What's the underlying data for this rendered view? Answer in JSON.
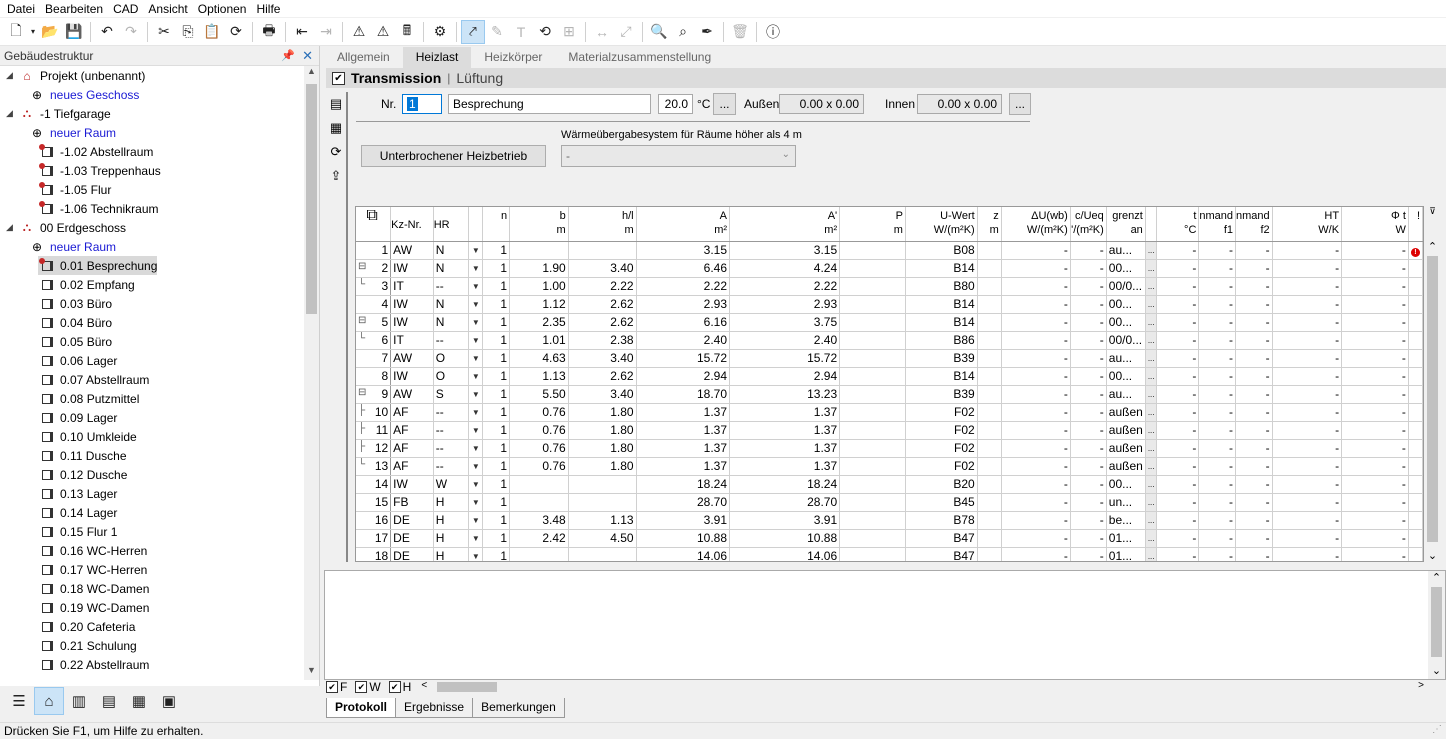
{
  "menu": [
    "Datei",
    "Bearbeiten",
    "CAD",
    "Ansicht",
    "Optionen",
    "Hilfe"
  ],
  "left_panel": {
    "title": "Gebäudestruktur",
    "tree": [
      {
        "label": "Projekt (unbenannt)",
        "level": 0,
        "icon": "project-icon",
        "exp": "◢"
      },
      {
        "label": "neues Geschoss",
        "level": 1,
        "icon": "add-icon",
        "blue": true
      },
      {
        "label": "-1 Tiefgarage",
        "level": 0,
        "icon": "floor-icon",
        "exp": "◢"
      },
      {
        "label": "neuer Raum",
        "level": 1,
        "icon": "add-icon",
        "blue": true
      },
      {
        "label": "-1.02 Abstellraum",
        "level": 1,
        "icon": "room-warn-icon"
      },
      {
        "label": "-1.03 Treppenhaus",
        "level": 1,
        "icon": "room-warn-icon"
      },
      {
        "label": "-1.05 Flur",
        "level": 1,
        "icon": "room-warn-icon"
      },
      {
        "label": "-1.06 Technikraum",
        "level": 1,
        "icon": "room-warn-icon"
      },
      {
        "label": "00 Erdgeschoss",
        "level": 0,
        "icon": "floor-icon",
        "exp": "◢"
      },
      {
        "label": "neuer Raum",
        "level": 1,
        "icon": "add-icon",
        "blue": true
      },
      {
        "label": "0.01 Besprechung",
        "level": 1,
        "icon": "room-warn-icon",
        "selected": true
      },
      {
        "label": "0.02 Empfang",
        "level": 1,
        "icon": "room-icon"
      },
      {
        "label": "0.03 Büro",
        "level": 1,
        "icon": "room-icon"
      },
      {
        "label": "0.04 Büro",
        "level": 1,
        "icon": "room-icon"
      },
      {
        "label": "0.05 Büro",
        "level": 1,
        "icon": "room-icon"
      },
      {
        "label": "0.06 Lager",
        "level": 1,
        "icon": "room-icon"
      },
      {
        "label": "0.07 Abstellraum",
        "level": 1,
        "icon": "room-icon"
      },
      {
        "label": "0.08 Putzmittel",
        "level": 1,
        "icon": "room-icon"
      },
      {
        "label": "0.09 Lager",
        "level": 1,
        "icon": "room-icon"
      },
      {
        "label": "0.10 Umkleide",
        "level": 1,
        "icon": "room-icon"
      },
      {
        "label": "0.11 Dusche",
        "level": 1,
        "icon": "room-icon"
      },
      {
        "label": "0.12 Dusche",
        "level": 1,
        "icon": "room-icon"
      },
      {
        "label": "0.13 Lager",
        "level": 1,
        "icon": "room-icon"
      },
      {
        "label": "0.14 Lager",
        "level": 1,
        "icon": "room-icon"
      },
      {
        "label": "0.15 Flur 1",
        "level": 1,
        "icon": "room-icon"
      },
      {
        "label": "0.16 WC-Herren",
        "level": 1,
        "icon": "room-icon"
      },
      {
        "label": "0.17 WC-Herren",
        "level": 1,
        "icon": "room-icon"
      },
      {
        "label": "0.18 WC-Damen",
        "level": 1,
        "icon": "room-icon"
      },
      {
        "label": "0.19 WC-Damen",
        "level": 1,
        "icon": "room-icon"
      },
      {
        "label": "0.20 Cafeteria",
        "level": 1,
        "icon": "room-icon"
      },
      {
        "label": "0.21 Schulung",
        "level": 1,
        "icon": "room-icon"
      },
      {
        "label": "0.22 Abstellraum",
        "level": 1,
        "icon": "room-icon"
      }
    ]
  },
  "tabs": [
    "Allgemein",
    "Heizlast",
    "Heizkörper",
    "Materialzusammenstellung"
  ],
  "active_tab": "Heizlast",
  "section": {
    "title": "Transmission",
    "sub": "Lüftung"
  },
  "form": {
    "nr_label": "Nr.",
    "nr_value": "1",
    "name": "Besprechung",
    "temp": "20.0",
    "unit": "°C",
    "dots": "...",
    "aussen_label": "Außen",
    "aussen_value": "0.00 x 0.00",
    "innen_label": "Innen",
    "innen_value": "0.00 x 0.00",
    "interrupt_button": "Unterbrochener Heizbetrieb",
    "system_label": "Wärmeübergabesystem für Räume höher als 4 m",
    "system_value": "-"
  },
  "columns": [
    {
      "h1": "",
      "h2": ""
    },
    {
      "h1": "Kz-Nr.",
      "h2": ""
    },
    {
      "h1": "HR",
      "h2": ""
    },
    {
      "h1": "",
      "h2": ""
    },
    {
      "h1": "n",
      "h2": ""
    },
    {
      "h1": "b",
      "h2": "m"
    },
    {
      "h1": "h/l",
      "h2": "m"
    },
    {
      "h1": "A",
      "h2": "m²"
    },
    {
      "h1": "A'",
      "h2": "m²"
    },
    {
      "h1": "P",
      "h2": "m"
    },
    {
      "h1": "U-Wert",
      "h2": "W/(m²K)"
    },
    {
      "h1": "z",
      "h2": "m"
    },
    {
      "h1": "ΔU(wb)",
      "h2": "W/(m²K)"
    },
    {
      "h1": "c/Ueq",
      "h2": "'/(m²K)"
    },
    {
      "h1": "grenzt",
      "h2": "an"
    },
    {
      "h1": "",
      "h2": ""
    },
    {
      "h1": "t",
      "h2": "°C"
    },
    {
      "h1": "nmand",
      "h2": "f1"
    },
    {
      "h1": "nmand",
      "h2": "f2"
    },
    {
      "h1": "HT",
      "h2": "W/K"
    },
    {
      "h1": "Φ t",
      "h2": "W"
    },
    {
      "h1": "!",
      "h2": ""
    }
  ],
  "rows": [
    {
      "n": "1",
      "kz": "AW",
      "hr": "N",
      "cnt": "1",
      "b": "",
      "h": "",
      "a": "3.15",
      "a2": "3.15",
      "u": "B08",
      "g": "au...",
      "warn": true,
      "tree": ""
    },
    {
      "n": "2",
      "kz": "IW",
      "hr": "N",
      "cnt": "1",
      "b": "1.90",
      "h": "3.40",
      "a": "6.46",
      "a2": "4.24",
      "u": "B14",
      "g": "00...",
      "tree": "⊟"
    },
    {
      "n": "3",
      "kz": "IT",
      "hr": "--",
      "cnt": "1",
      "b": "1.00",
      "h": "2.22",
      "a": "2.22",
      "a2": "2.22",
      "u": "B80",
      "g": "00/0...",
      "tree": "└"
    },
    {
      "n": "4",
      "kz": "IW",
      "hr": "N",
      "cnt": "1",
      "b": "1.12",
      "h": "2.62",
      "a": "2.93",
      "a2": "2.93",
      "u": "B14",
      "g": "00...",
      "tree": ""
    },
    {
      "n": "5",
      "kz": "IW",
      "hr": "N",
      "cnt": "1",
      "b": "2.35",
      "h": "2.62",
      "a": "6.16",
      "a2": "3.75",
      "u": "B14",
      "g": "00...",
      "tree": "⊟"
    },
    {
      "n": "6",
      "kz": "IT",
      "hr": "--",
      "cnt": "1",
      "b": "1.01",
      "h": "2.38",
      "a": "2.40",
      "a2": "2.40",
      "u": "B86",
      "g": "00/0...",
      "tree": "└"
    },
    {
      "n": "7",
      "kz": "AW",
      "hr": "O",
      "cnt": "1",
      "b": "4.63",
      "h": "3.40",
      "a": "15.72",
      "a2": "15.72",
      "u": "B39",
      "g": "au...",
      "tree": ""
    },
    {
      "n": "8",
      "kz": "IW",
      "hr": "O",
      "cnt": "1",
      "b": "1.13",
      "h": "2.62",
      "a": "2.94",
      "a2": "2.94",
      "u": "B14",
      "g": "00...",
      "tree": ""
    },
    {
      "n": "9",
      "kz": "AW",
      "hr": "S",
      "cnt": "1",
      "b": "5.50",
      "h": "3.40",
      "a": "18.70",
      "a2": "13.23",
      "u": "B39",
      "g": "au...",
      "tree": "⊟"
    },
    {
      "n": "10",
      "kz": "AF",
      "hr": "--",
      "cnt": "1",
      "b": "0.76",
      "h": "1.80",
      "a": "1.37",
      "a2": "1.37",
      "u": "F02",
      "g": "außen",
      "tree": "├"
    },
    {
      "n": "11",
      "kz": "AF",
      "hr": "--",
      "cnt": "1",
      "b": "0.76",
      "h": "1.80",
      "a": "1.37",
      "a2": "1.37",
      "u": "F02",
      "g": "außen",
      "tree": "├"
    },
    {
      "n": "12",
      "kz": "AF",
      "hr": "--",
      "cnt": "1",
      "b": "0.76",
      "h": "1.80",
      "a": "1.37",
      "a2": "1.37",
      "u": "F02",
      "g": "außen",
      "tree": "├"
    },
    {
      "n": "13",
      "kz": "AF",
      "hr": "--",
      "cnt": "1",
      "b": "0.76",
      "h": "1.80",
      "a": "1.37",
      "a2": "1.37",
      "u": "F02",
      "g": "außen",
      "tree": "└"
    },
    {
      "n": "14",
      "kz": "IW",
      "hr": "W",
      "cnt": "1",
      "b": "",
      "h": "",
      "a": "18.24",
      "a2": "18.24",
      "u": "B20",
      "g": "00...",
      "tree": ""
    },
    {
      "n": "15",
      "kz": "FB",
      "hr": "H",
      "cnt": "1",
      "b": "",
      "h": "",
      "a": "28.70",
      "a2": "28.70",
      "u": "B45",
      "g": "un...",
      "tree": ""
    },
    {
      "n": "16",
      "kz": "DE",
      "hr": "H",
      "cnt": "1",
      "b": "3.48",
      "h": "1.13",
      "a": "3.91",
      "a2": "3.91",
      "u": "B78",
      "g": "be...",
      "tree": ""
    },
    {
      "n": "17",
      "kz": "DE",
      "hr": "H",
      "cnt": "1",
      "b": "2.42",
      "h": "4.50",
      "a": "10.88",
      "a2": "10.88",
      "u": "B47",
      "g": "01...",
      "tree": ""
    },
    {
      "n": "18",
      "kz": "DE",
      "hr": "H",
      "cnt": "1",
      "b": "",
      "h": "",
      "a": "14.06",
      "a2": "14.06",
      "u": "B47",
      "g": "01...",
      "tree": ""
    }
  ],
  "dash": "-",
  "ellipsis": "...",
  "log_filters": [
    {
      "label": "F"
    },
    {
      "label": "W"
    },
    {
      "label": "H"
    }
  ],
  "bottom_tabs": [
    "Protokoll",
    "Ergebnisse",
    "Bemerkungen"
  ],
  "active_bottom_tab": "Protokoll",
  "status": "Drücken Sie F1, um Hilfe zu erhalten."
}
